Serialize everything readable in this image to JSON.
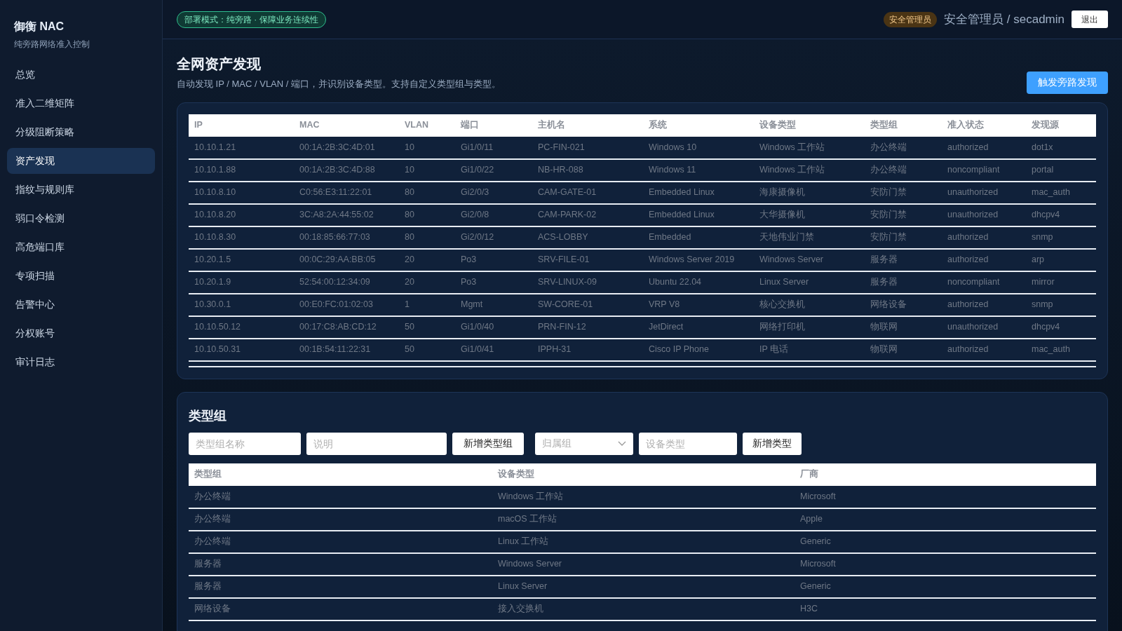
{
  "brand": {
    "title": "御衡 NAC",
    "subtitle": "纯旁路网络准入控制"
  },
  "sidebar": {
    "items": [
      {
        "label": "总览",
        "selected": false
      },
      {
        "label": "准入二维矩阵",
        "selected": false
      },
      {
        "label": "分级阻断策略",
        "selected": false
      },
      {
        "label": "资产发现",
        "selected": true
      },
      {
        "label": "指纹与规则库",
        "selected": false
      },
      {
        "label": "弱口令检测",
        "selected": false
      },
      {
        "label": "高危端口库",
        "selected": false
      },
      {
        "label": "专项扫描",
        "selected": false
      },
      {
        "label": "告警中心",
        "selected": false
      },
      {
        "label": "分权账号",
        "selected": false
      },
      {
        "label": "审计日志",
        "selected": false
      }
    ]
  },
  "header": {
    "mode_badge": "部署模式：纯旁路 · 保障业务连续性",
    "role_badge": "安全管理员",
    "user": "安全管理员 / secadmin",
    "logout": "退出"
  },
  "page": {
    "title": "全网资产发现",
    "description": "自动发现 IP / MAC / VLAN / 端口，并识别设备类型。支持自定义类型组与类型。",
    "action": "触发旁路发现"
  },
  "assets_table": {
    "columns": [
      "IP",
      "MAC",
      "VLAN",
      "端口",
      "主机名",
      "系统",
      "设备类型",
      "类型组",
      "准入状态",
      "发现源"
    ],
    "rows": [
      [
        "10.10.1.21",
        "00:1A:2B:3C:4D:01",
        "10",
        "Gi1/0/11",
        "PC-FIN-021",
        "Windows 10",
        "Windows 工作站",
        "办公终端",
        "authorized",
        "dot1x"
      ],
      [
        "10.10.1.88",
        "00:1A:2B:3C:4D:88",
        "10",
        "Gi1/0/22",
        "NB-HR-088",
        "Windows 11",
        "Windows 工作站",
        "办公终端",
        "noncompliant",
        "portal"
      ],
      [
        "10.10.8.10",
        "C0:56:E3:11:22:01",
        "80",
        "Gi2/0/3",
        "CAM-GATE-01",
        "Embedded Linux",
        "海康摄像机",
        "安防门禁",
        "unauthorized",
        "mac_auth"
      ],
      [
        "10.10.8.20",
        "3C:A8:2A:44:55:02",
        "80",
        "Gi2/0/8",
        "CAM-PARK-02",
        "Embedded Linux",
        "大华摄像机",
        "安防门禁",
        "unauthorized",
        "dhcpv4"
      ],
      [
        "10.10.8.30",
        "00:18:85:66:77:03",
        "80",
        "Gi2/0/12",
        "ACS-LOBBY",
        "Embedded",
        "天地伟业门禁",
        "安防门禁",
        "authorized",
        "snmp"
      ],
      [
        "10.20.1.5",
        "00:0C:29:AA:BB:05",
        "20",
        "Po3",
        "SRV-FILE-01",
        "Windows Server 2019",
        "Windows Server",
        "服务器",
        "authorized",
        "arp"
      ],
      [
        "10.20.1.9",
        "52:54:00:12:34:09",
        "20",
        "Po3",
        "SRV-LINUX-09",
        "Ubuntu 22.04",
        "Linux Server",
        "服务器",
        "noncompliant",
        "mirror"
      ],
      [
        "10.30.0.1",
        "00:E0:FC:01:02:03",
        "1",
        "Mgmt",
        "SW-CORE-01",
        "VRP V8",
        "核心交换机",
        "网络设备",
        "authorized",
        "snmp"
      ],
      [
        "10.10.50.12",
        "00:17:C8:AB:CD:12",
        "50",
        "Gi1/0/40",
        "PRN-FIN-12",
        "JetDirect",
        "网络打印机",
        "物联网",
        "unauthorized",
        "dhcpv4"
      ],
      [
        "10.10.50.31",
        "00:1B:54:11:22:31",
        "50",
        "Gi1/0/41",
        "IPPH-31",
        "Cisco IP Phone",
        "IP 电话",
        "物联网",
        "authorized",
        "mac_auth"
      ]
    ]
  },
  "type_groups": {
    "title": "类型组",
    "group_name": {
      "placeholder": "类型组名称"
    },
    "description": {
      "placeholder": "说明"
    },
    "add_group": "新增类型组",
    "parent_group": {
      "placeholder": "归属组"
    },
    "device_type": {
      "placeholder": "设备类型"
    },
    "add_type": "新增类型",
    "columns": [
      "类型组",
      "设备类型",
      "厂商"
    ],
    "rows": [
      [
        "办公终端",
        "Windows 工作站",
        "Microsoft"
      ],
      [
        "办公终端",
        "macOS 工作站",
        "Apple"
      ],
      [
        "办公终端",
        "Linux 工作站",
        "Generic"
      ],
      [
        "服务器",
        "Windows Server",
        "Microsoft"
      ],
      [
        "服务器",
        "Linux Server",
        "Generic"
      ],
      [
        "网络设备",
        "接入交换机",
        "H3C"
      ]
    ]
  }
}
